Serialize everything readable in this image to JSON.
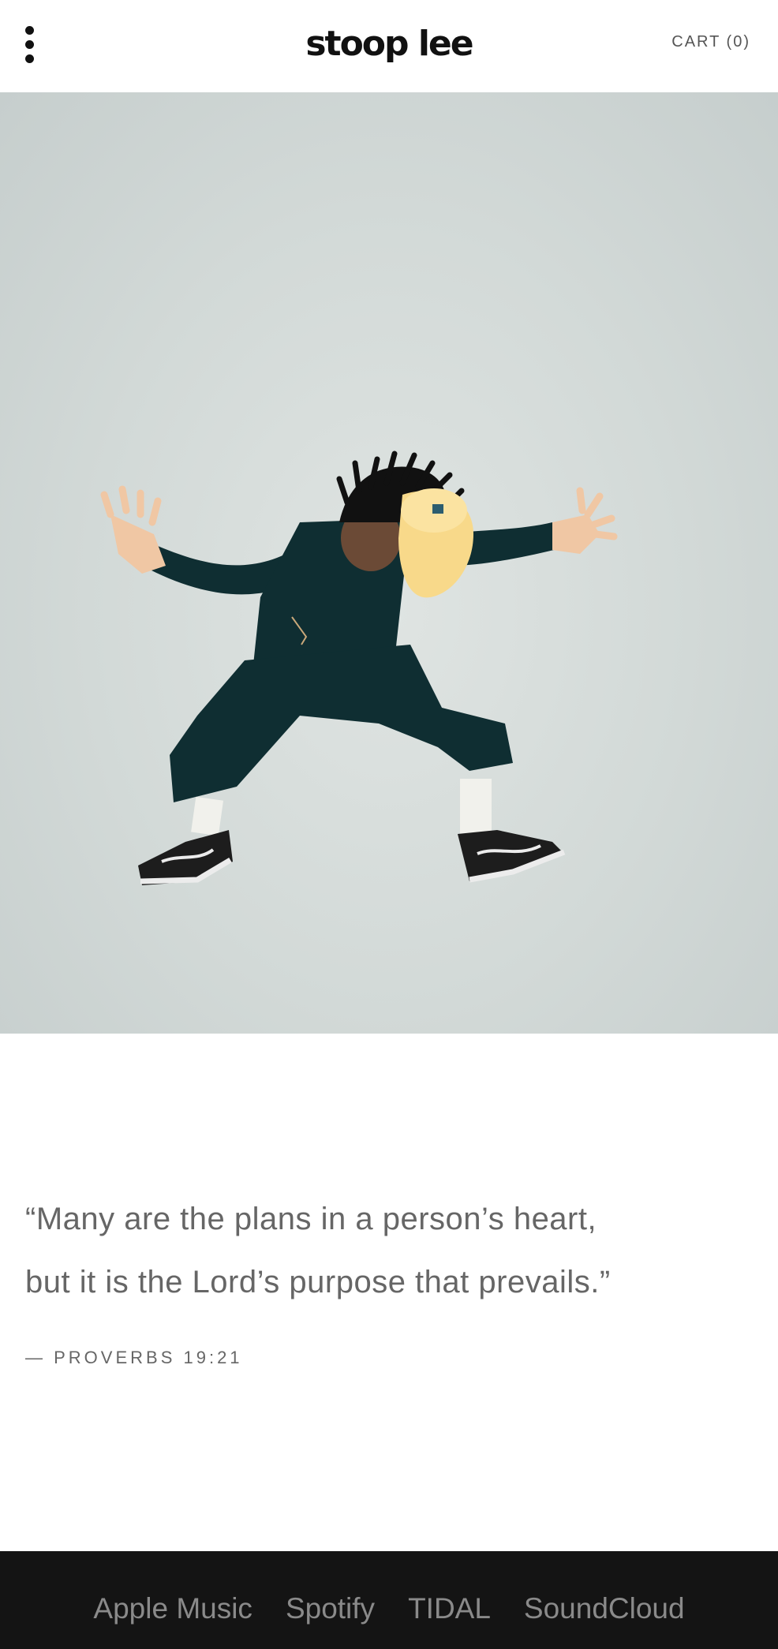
{
  "header": {
    "logo": "stoop lee",
    "cart_label": "CART (0)"
  },
  "hero": {
    "image_subject": "person-jumping-photo"
  },
  "quote": {
    "line1": "“Many are the plans in a person’s heart,",
    "line2": "but it is the Lord’s purpose that prevails.”",
    "citation": "— PROVERBS 19:21"
  },
  "footer": {
    "links": [
      "Apple Music",
      "Spotify",
      "TIDAL",
      "SoundCloud"
    ]
  },
  "colors": {
    "header_bg": "#ffffff",
    "hero_bg": "#d2d9d7",
    "text": "#666666",
    "footer_bg": "#141414",
    "footer_text": "#8a8a8a"
  }
}
